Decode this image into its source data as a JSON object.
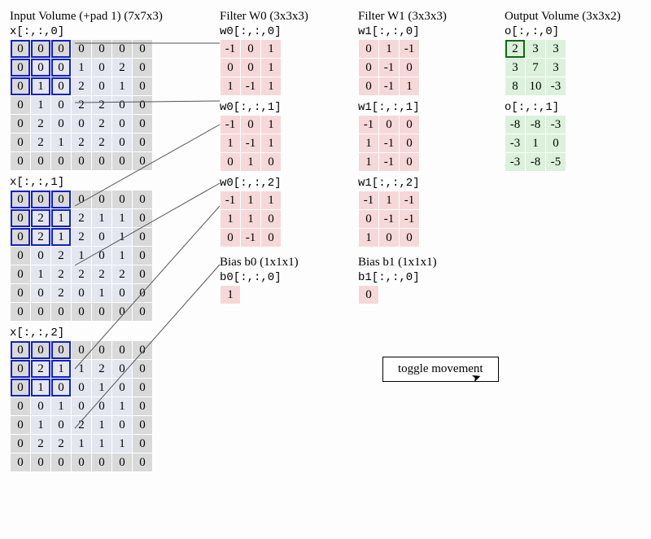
{
  "input": {
    "title": "Input Volume (+pad 1) (7x7x3)",
    "slices": [
      {
        "label": "x[:,:,0]",
        "rows": [
          [
            0,
            0,
            0,
            0,
            0,
            0,
            0
          ],
          [
            0,
            0,
            0,
            1,
            0,
            2,
            0
          ],
          [
            0,
            1,
            0,
            2,
            0,
            1,
            0
          ],
          [
            0,
            1,
            0,
            2,
            2,
            0,
            0
          ],
          [
            0,
            2,
            0,
            0,
            2,
            0,
            0
          ],
          [
            0,
            2,
            1,
            2,
            2,
            0,
            0
          ],
          [
            0,
            0,
            0,
            0,
            0,
            0,
            0
          ]
        ]
      },
      {
        "label": "x[:,:,1]",
        "rows": [
          [
            0,
            0,
            0,
            0,
            0,
            0,
            0
          ],
          [
            0,
            2,
            1,
            2,
            1,
            1,
            0
          ],
          [
            0,
            2,
            1,
            2,
            0,
            1,
            0
          ],
          [
            0,
            0,
            2,
            1,
            0,
            1,
            0
          ],
          [
            0,
            1,
            2,
            2,
            2,
            2,
            0
          ],
          [
            0,
            0,
            2,
            0,
            1,
            0,
            0
          ],
          [
            0,
            0,
            0,
            0,
            0,
            0,
            0
          ]
        ]
      },
      {
        "label": "x[:,:,2]",
        "rows": [
          [
            0,
            0,
            0,
            0,
            0,
            0,
            0
          ],
          [
            0,
            2,
            1,
            1,
            2,
            0,
            0
          ],
          [
            0,
            1,
            0,
            0,
            1,
            0,
            0
          ],
          [
            0,
            0,
            1,
            0,
            0,
            1,
            0
          ],
          [
            0,
            1,
            0,
            2,
            1,
            0,
            0
          ],
          [
            0,
            2,
            2,
            1,
            1,
            1,
            0
          ],
          [
            0,
            0,
            0,
            0,
            0,
            0,
            0
          ]
        ]
      }
    ]
  },
  "w0": {
    "title": "Filter W0 (3x3x3)",
    "slices": [
      {
        "label": "w0[:,:,0]",
        "rows": [
          [
            -1,
            0,
            1
          ],
          [
            0,
            0,
            1
          ],
          [
            1,
            -1,
            1
          ]
        ]
      },
      {
        "label": "w0[:,:,1]",
        "rows": [
          [
            -1,
            0,
            1
          ],
          [
            1,
            -1,
            1
          ],
          [
            0,
            1,
            0
          ]
        ]
      },
      {
        "label": "w0[:,:,2]",
        "rows": [
          [
            -1,
            1,
            1
          ],
          [
            1,
            1,
            0
          ],
          [
            0,
            -1,
            0
          ]
        ]
      }
    ],
    "bias_title": "Bias b0 (1x1x1)",
    "bias_label": "b0[:,:,0]",
    "bias_value": 1
  },
  "w1": {
    "title": "Filter W1 (3x3x3)",
    "slices": [
      {
        "label": "w1[:,:,0]",
        "rows": [
          [
            0,
            1,
            -1
          ],
          [
            0,
            -1,
            0
          ],
          [
            0,
            -1,
            1
          ]
        ]
      },
      {
        "label": "w1[:,:,1]",
        "rows": [
          [
            -1,
            0,
            0
          ],
          [
            1,
            -1,
            0
          ],
          [
            1,
            -1,
            0
          ]
        ]
      },
      {
        "label": "w1[:,:,2]",
        "rows": [
          [
            -1,
            1,
            -1
          ],
          [
            0,
            -1,
            -1
          ],
          [
            1,
            0,
            0
          ]
        ]
      }
    ],
    "bias_title": "Bias b1 (1x1x1)",
    "bias_label": "b1[:,:,0]",
    "bias_value": 0
  },
  "out": {
    "title": "Output Volume (3x3x2)",
    "slices": [
      {
        "label": "o[:,:,0]",
        "rows": [
          [
            2,
            3,
            3
          ],
          [
            3,
            7,
            3
          ],
          [
            8,
            10,
            -3
          ]
        ]
      },
      {
        "label": "o[:,:,1]",
        "rows": [
          [
            -8,
            -8,
            -3
          ],
          [
            -3,
            1,
            0
          ],
          [
            -3,
            -8,
            -5
          ]
        ]
      }
    ]
  },
  "button": "toggle movement"
}
